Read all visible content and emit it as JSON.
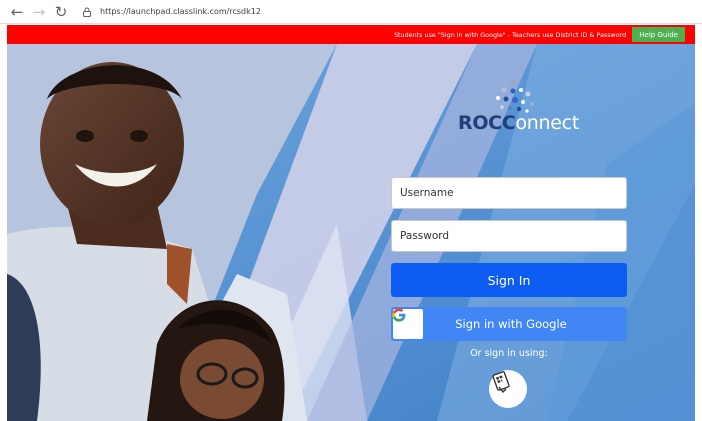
{
  "browser": {
    "url": "https://launchpad.classlink.com/rcsdk12",
    "icons": {
      "back": "back-arrow-icon",
      "forward": "forward-arrow-icon",
      "reload": "reload-icon",
      "secure": "lock-icon"
    }
  },
  "banner": {
    "text": "Students use \"Sign in with Google\" - Teachers use District ID & Password",
    "help_label": "Help Guide",
    "color": "#ff0000",
    "help_color": "#4caf50"
  },
  "logo": {
    "text_bold": "ROC",
    "text_thin": "onnect",
    "c_letter": "C"
  },
  "form": {
    "username_placeholder": "Username",
    "password_placeholder": "Password",
    "signin_label": "Sign In",
    "google_label": "Sign in with Google",
    "alt_signin_label": "Or sign in using:",
    "signin_color": "#0d5cf2",
    "google_color": "#4285f4"
  }
}
